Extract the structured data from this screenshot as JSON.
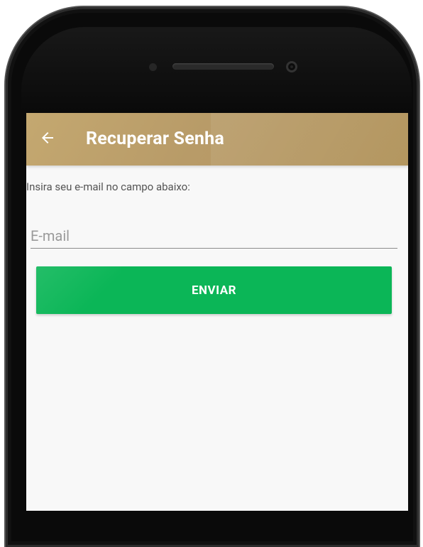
{
  "app_bar": {
    "title": "Recuperar Senha",
    "back_icon": "arrow-left-icon",
    "color": "#b89b68"
  },
  "form": {
    "instructions": "Insira seu e-mail no campo abaixo:",
    "email_value": "",
    "email_placeholder": "E-mail",
    "submit_label": "ENVIAR",
    "submit_color": "#0bb657"
  }
}
